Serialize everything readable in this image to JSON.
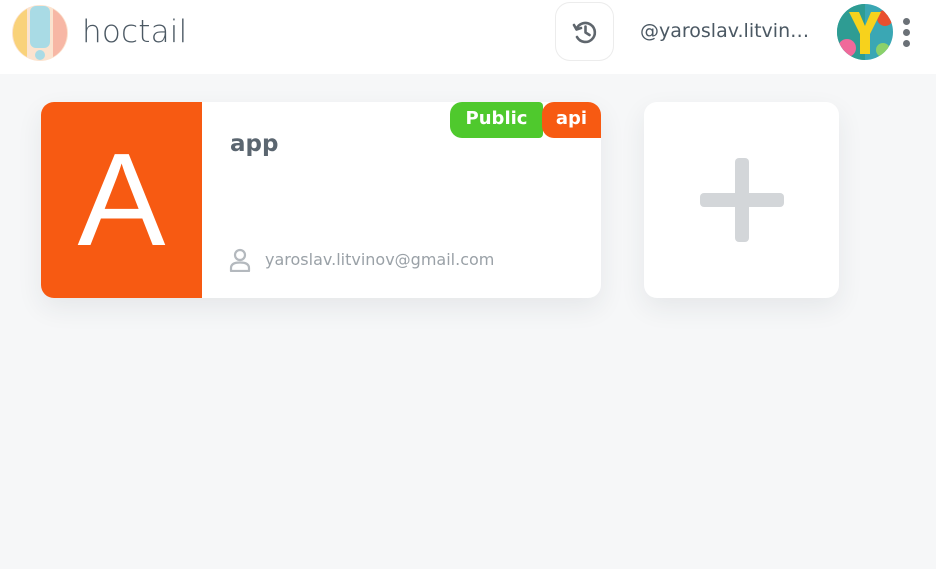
{
  "header": {
    "logo_text": "hoctail",
    "username": "@yaroslav.litvinov",
    "icons": {
      "history": "history-icon",
      "more": "more-vertical-icon",
      "avatar_letter": "Y"
    }
  },
  "apps": [
    {
      "initial": "A",
      "name": "app",
      "badges": [
        "Public",
        "api"
      ],
      "owner_email": "yaroslav.litvinov@gmail.com",
      "tile_color": "#f75a12"
    }
  ],
  "add_card": {
    "icon": "plus-icon"
  },
  "colors": {
    "accent_orange": "#f75a12",
    "public_green": "#4fc92d",
    "background": "#f6f7f8",
    "text": "#4b5863"
  }
}
